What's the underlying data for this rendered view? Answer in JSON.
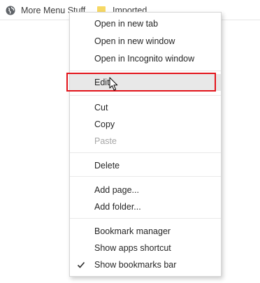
{
  "bookmarks_bar": {
    "items": [
      {
        "label": "More Menu Stuff",
        "icon": "globe-icon"
      },
      {
        "label": "Imported",
        "icon": "folder-icon"
      }
    ]
  },
  "context_menu": {
    "items": [
      {
        "label": "Open in new tab",
        "enabled": true
      },
      {
        "label": "Open in new window",
        "enabled": true
      },
      {
        "label": "Open in Incognito window",
        "enabled": true
      },
      {
        "label": "Edit...",
        "enabled": true,
        "highlighted": true
      },
      {
        "label": "Cut",
        "enabled": true
      },
      {
        "label": "Copy",
        "enabled": true
      },
      {
        "label": "Paste",
        "enabled": false
      },
      {
        "label": "Delete",
        "enabled": true
      },
      {
        "label": "Add page...",
        "enabled": true
      },
      {
        "label": "Add folder...",
        "enabled": true
      },
      {
        "label": "Bookmark manager",
        "enabled": true
      },
      {
        "label": "Show apps shortcut",
        "enabled": true
      },
      {
        "label": "Show bookmarks bar",
        "enabled": true,
        "checked": true
      }
    ]
  },
  "colors": {
    "highlight_box": "#e3141b",
    "disabled_text": "#a6a6a6",
    "folder": "#f6d864"
  }
}
